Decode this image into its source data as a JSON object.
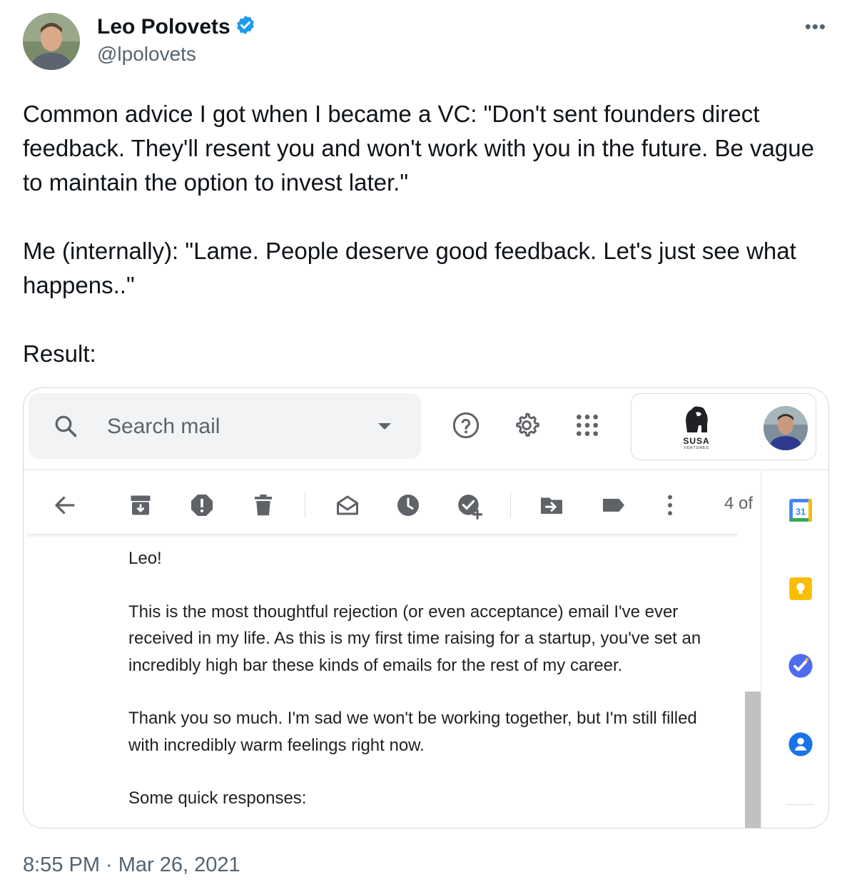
{
  "author": {
    "name": "Leo Polovets",
    "handle": "@lpolovets",
    "verified_icon": "verified-badge-icon"
  },
  "more_label": "•••",
  "tweet": {
    "p1": "Common advice I got when I became a VC: \"Don't sent founders direct feedback. They'll resent you and won't work with you in the future. Be vague to maintain the option to invest later.\"",
    "p2": "Me (internally): \"Lame. People deserve good feedback. Let's just see what happens..\"",
    "p3": "Result:"
  },
  "gmail": {
    "search_placeholder": "Search mail",
    "brand_text": "SUSA",
    "brand_sub": "VENTURES",
    "message_count": "4 of",
    "calendar_day": "31",
    "colors": {
      "calendar_blue": "#4285f4",
      "keep_yellow": "#fbbc04",
      "tasks_blue": "#4f6cf0",
      "contacts_blue": "#1a73e8"
    },
    "email_body": {
      "greeting": "Leo!",
      "p1": "This is the most thoughtful rejection (or even acceptance) email I've ever received in my life. As this is my first time raising for a startup, you've set an incredibly high bar these kinds of emails for the rest of my career.",
      "p2": "Thank you so much. I'm sad we won't be working together, but I'm still filled with incredibly warm feelings right now.",
      "p3": "Some quick responses:"
    }
  },
  "timestamp": "8:55 PM · Mar 26, 2021"
}
